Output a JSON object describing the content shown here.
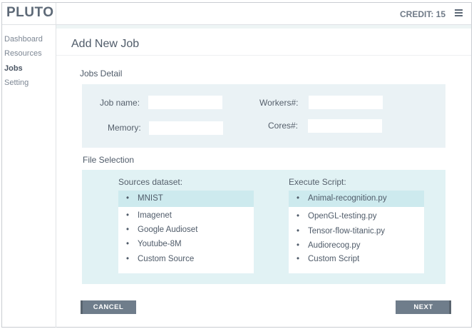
{
  "app": {
    "logo": "PLUTO",
    "credit": "CREDIT: 15"
  },
  "sidebar": {
    "items": [
      {
        "label": "Dashboard"
      },
      {
        "label": "Resources"
      },
      {
        "label": "Jobs"
      },
      {
        "label": "Setting"
      }
    ]
  },
  "page": {
    "title": "Add New Job"
  },
  "jobs_detail": {
    "title": "Jobs Detail",
    "job_name": {
      "label": "Job name:",
      "value": ""
    },
    "workers": {
      "label": "Workers#:",
      "value": ""
    },
    "memory": {
      "label": "Memory:",
      "value": ""
    },
    "cores": {
      "label": "Cores#:",
      "value": ""
    }
  },
  "file_selection": {
    "title": "File Selection",
    "sources": {
      "title": "Sources dataset:",
      "items": [
        "MNIST",
        "Imagenet",
        "Google Audioset",
        "Youtube-8M",
        "Custom Source"
      ],
      "selected": "MNIST"
    },
    "scripts": {
      "title": "Execute Script:",
      "items": [
        "Animal-recognition.py",
        "OpenGL-testing.py",
        "Tensor-flow-titanic.py",
        "Audiorecog.py",
        "Custom Script"
      ],
      "selected": "Animal-recognition.py"
    }
  },
  "actions": {
    "cancel": "CANCEL",
    "next": "NEXT"
  },
  "icons": {
    "menu": "hamburger-menu-icon"
  },
  "colors": {
    "button": "#6f7d8b",
    "selection": "#cdeaee",
    "panel": "#e1f2f4"
  }
}
